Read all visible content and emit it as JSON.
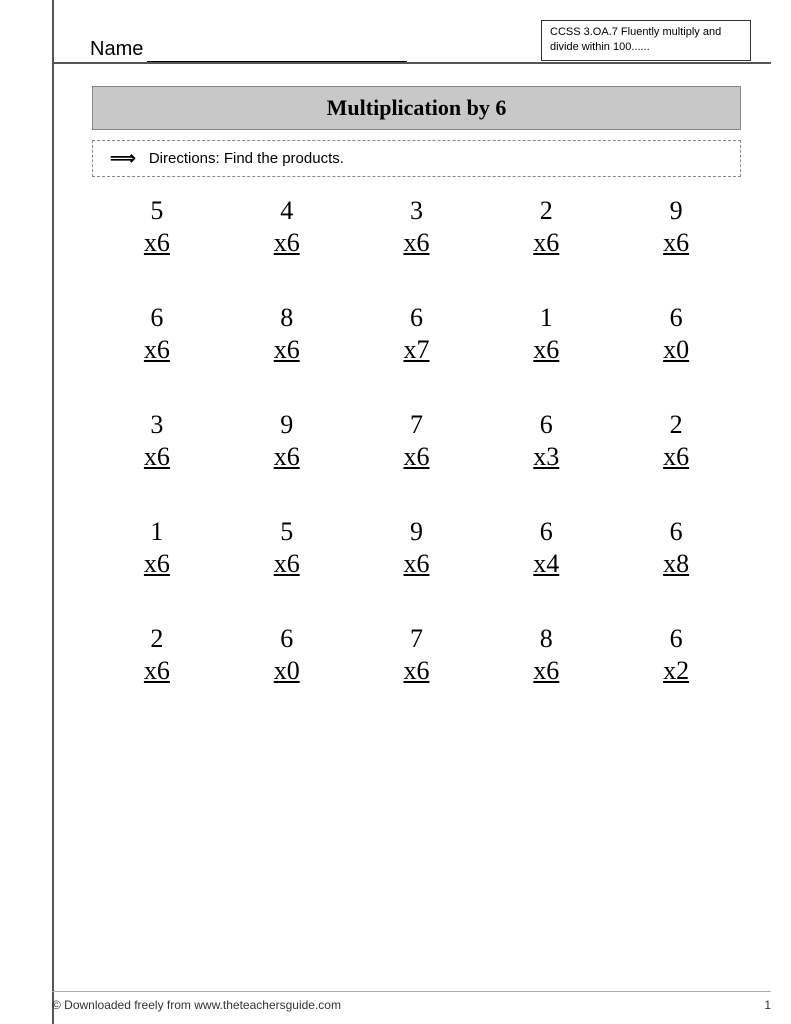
{
  "header": {
    "name_label": "Name",
    "name_underline": "___________________________",
    "ccss_text": "CCSS 3.OA.7 Fluently multiply and divide  within 100......"
  },
  "title": "Multiplication by 6",
  "directions": {
    "arrow": "==>",
    "text": "Directions: Find the products."
  },
  "rows": [
    [
      {
        "top": "5",
        "bottom": "x6"
      },
      {
        "top": "4",
        "bottom": "x6"
      },
      {
        "top": "3",
        "bottom": "x6"
      },
      {
        "top": "2",
        "bottom": "x6"
      },
      {
        "top": "9",
        "bottom": "x6"
      }
    ],
    [
      {
        "top": "6",
        "bottom": "x6"
      },
      {
        "top": "8",
        "bottom": "x6"
      },
      {
        "top": "6",
        "bottom": "x7"
      },
      {
        "top": "1",
        "bottom": "x6"
      },
      {
        "top": "6",
        "bottom": "x0"
      }
    ],
    [
      {
        "top": "3",
        "bottom": "x6"
      },
      {
        "top": "9",
        "bottom": "x6"
      },
      {
        "top": "7",
        "bottom": "x6"
      },
      {
        "top": "6",
        "bottom": "x3"
      },
      {
        "top": "2",
        "bottom": "x6"
      }
    ],
    [
      {
        "top": "1",
        "bottom": "x6"
      },
      {
        "top": "5",
        "bottom": "x6"
      },
      {
        "top": "9",
        "bottom": "x6"
      },
      {
        "top": "6",
        "bottom": "x4"
      },
      {
        "top": "6",
        "bottom": "x8"
      }
    ],
    [
      {
        "top": "2",
        "bottom": "x6"
      },
      {
        "top": "6",
        "bottom": "x0"
      },
      {
        "top": "7",
        "bottom": "x6"
      },
      {
        "top": "8",
        "bottom": "x6"
      },
      {
        "top": "6",
        "bottom": "x2"
      }
    ]
  ],
  "footer": {
    "copyright": "© Downloaded freely from www.theteachersguide.com",
    "page_number": "1"
  }
}
